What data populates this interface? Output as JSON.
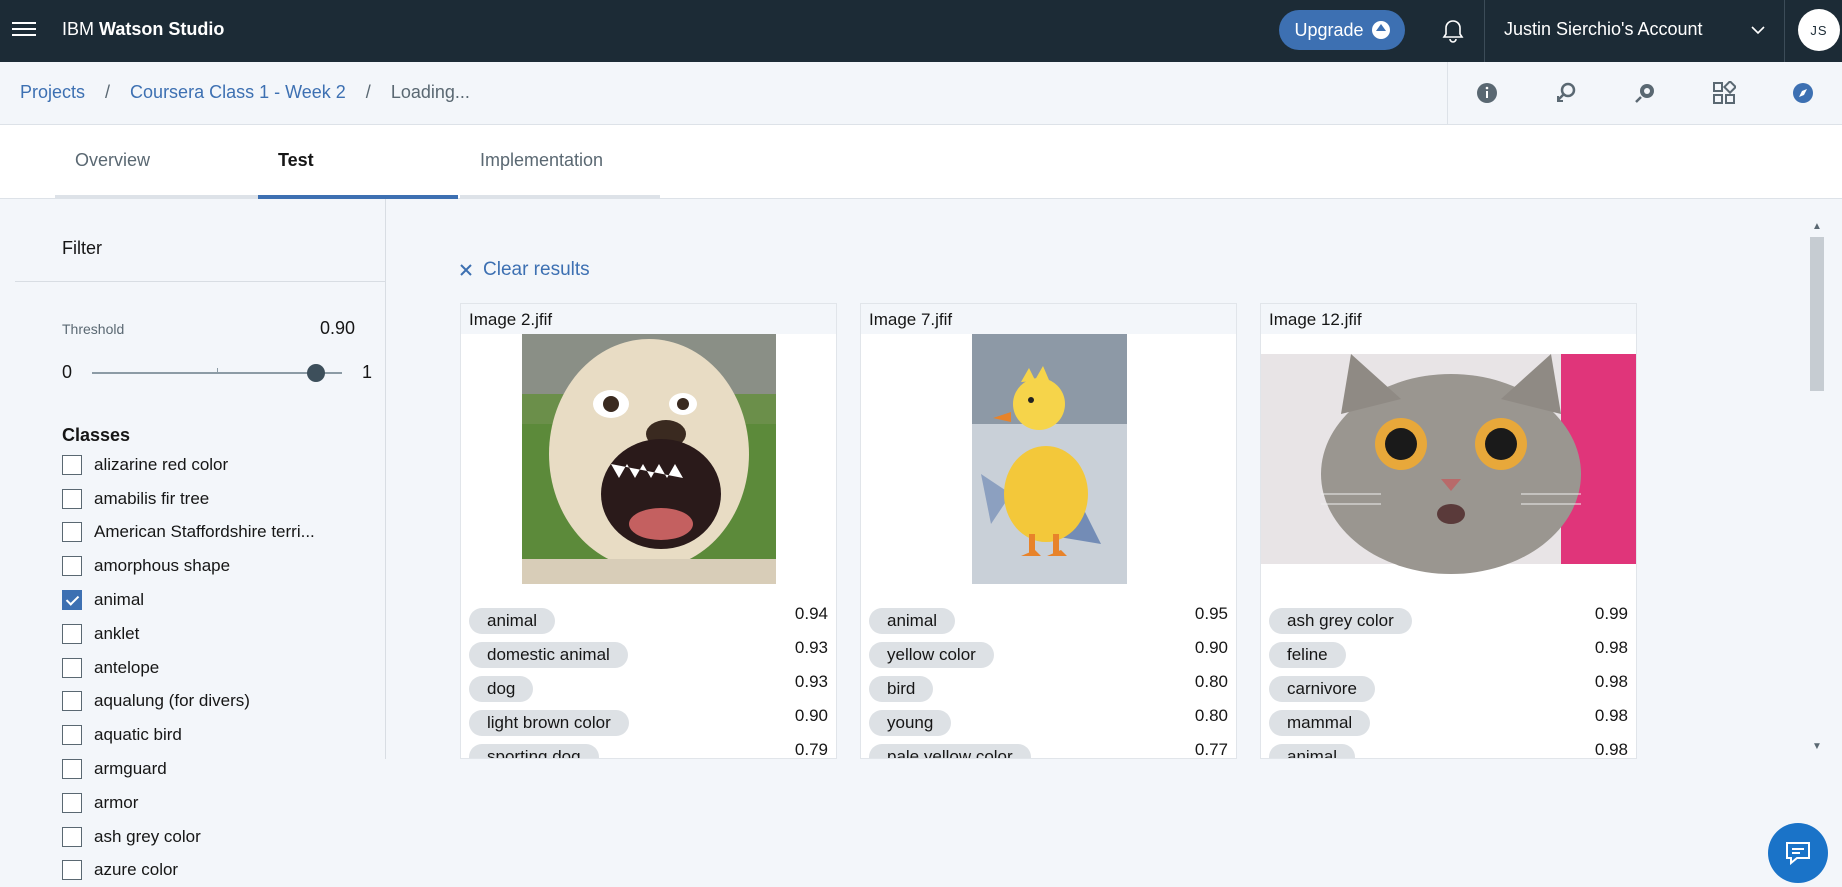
{
  "header": {
    "brand_prefix": "IBM",
    "brand_name": "Watson Studio",
    "upgrade_label": "Upgrade",
    "account_label": "Justin Sierchio's Account",
    "avatar_initials": "JS"
  },
  "breadcrumb": {
    "items": [
      "Projects",
      "Coursera Class 1 - Week 2"
    ],
    "separator": "/",
    "current": "Loading..."
  },
  "toolbar_icons": [
    "info-icon",
    "search-assets-icon",
    "deploy-icon",
    "grid-apps-icon",
    "compass-icon"
  ],
  "tabs": [
    {
      "label": "Overview",
      "active": false
    },
    {
      "label": "Test",
      "active": true
    },
    {
      "label": "Implementation",
      "active": false
    }
  ],
  "filter": {
    "title": "Filter",
    "threshold_label": "Threshold",
    "threshold_value": "0.90",
    "slider_min": "0",
    "slider_max": "1",
    "classes_title": "Classes",
    "classes": [
      {
        "label": "alizarine red color",
        "checked": false
      },
      {
        "label": "amabilis fir tree",
        "checked": false
      },
      {
        "label": "American Staffordshire terri...",
        "checked": false
      },
      {
        "label": "amorphous shape",
        "checked": false
      },
      {
        "label": "animal",
        "checked": true
      },
      {
        "label": "anklet",
        "checked": false
      },
      {
        "label": "antelope",
        "checked": false
      },
      {
        "label": "aqualung (for divers)",
        "checked": false
      },
      {
        "label": "aquatic bird",
        "checked": false
      },
      {
        "label": "armguard",
        "checked": false
      },
      {
        "label": "armor",
        "checked": false
      },
      {
        "label": "ash grey color",
        "checked": false
      },
      {
        "label": "azure color",
        "checked": false
      }
    ]
  },
  "results": {
    "clear_label": "Clear results",
    "cards": [
      {
        "title": "Image 2.jfif",
        "tags": [
          {
            "label": "animal",
            "score": "0.94"
          },
          {
            "label": "domestic animal",
            "score": "0.93"
          },
          {
            "label": "dog",
            "score": "0.93"
          },
          {
            "label": "light brown color",
            "score": "0.90"
          },
          {
            "label": "sporting dog",
            "score": "0.79"
          }
        ]
      },
      {
        "title": "Image 7.jfif",
        "tags": [
          {
            "label": "animal",
            "score": "0.95"
          },
          {
            "label": "yellow color",
            "score": "0.90"
          },
          {
            "label": "bird",
            "score": "0.80"
          },
          {
            "label": "young",
            "score": "0.80"
          },
          {
            "label": "pale yellow color",
            "score": "0.77"
          }
        ]
      },
      {
        "title": "Image 12.jfif",
        "tags": [
          {
            "label": "ash grey color",
            "score": "0.99"
          },
          {
            "label": "feline",
            "score": "0.98"
          },
          {
            "label": "carnivore",
            "score": "0.98"
          },
          {
            "label": "mammal",
            "score": "0.98"
          },
          {
            "label": "animal",
            "score": "0.98"
          }
        ]
      }
    ]
  },
  "colors": {
    "header_bg": "#1c2b36",
    "accent": "#3d70b2",
    "tag_bg": "#dde1e5",
    "page_bg": "#f3f6fa",
    "chat_button": "#1a73c8"
  }
}
